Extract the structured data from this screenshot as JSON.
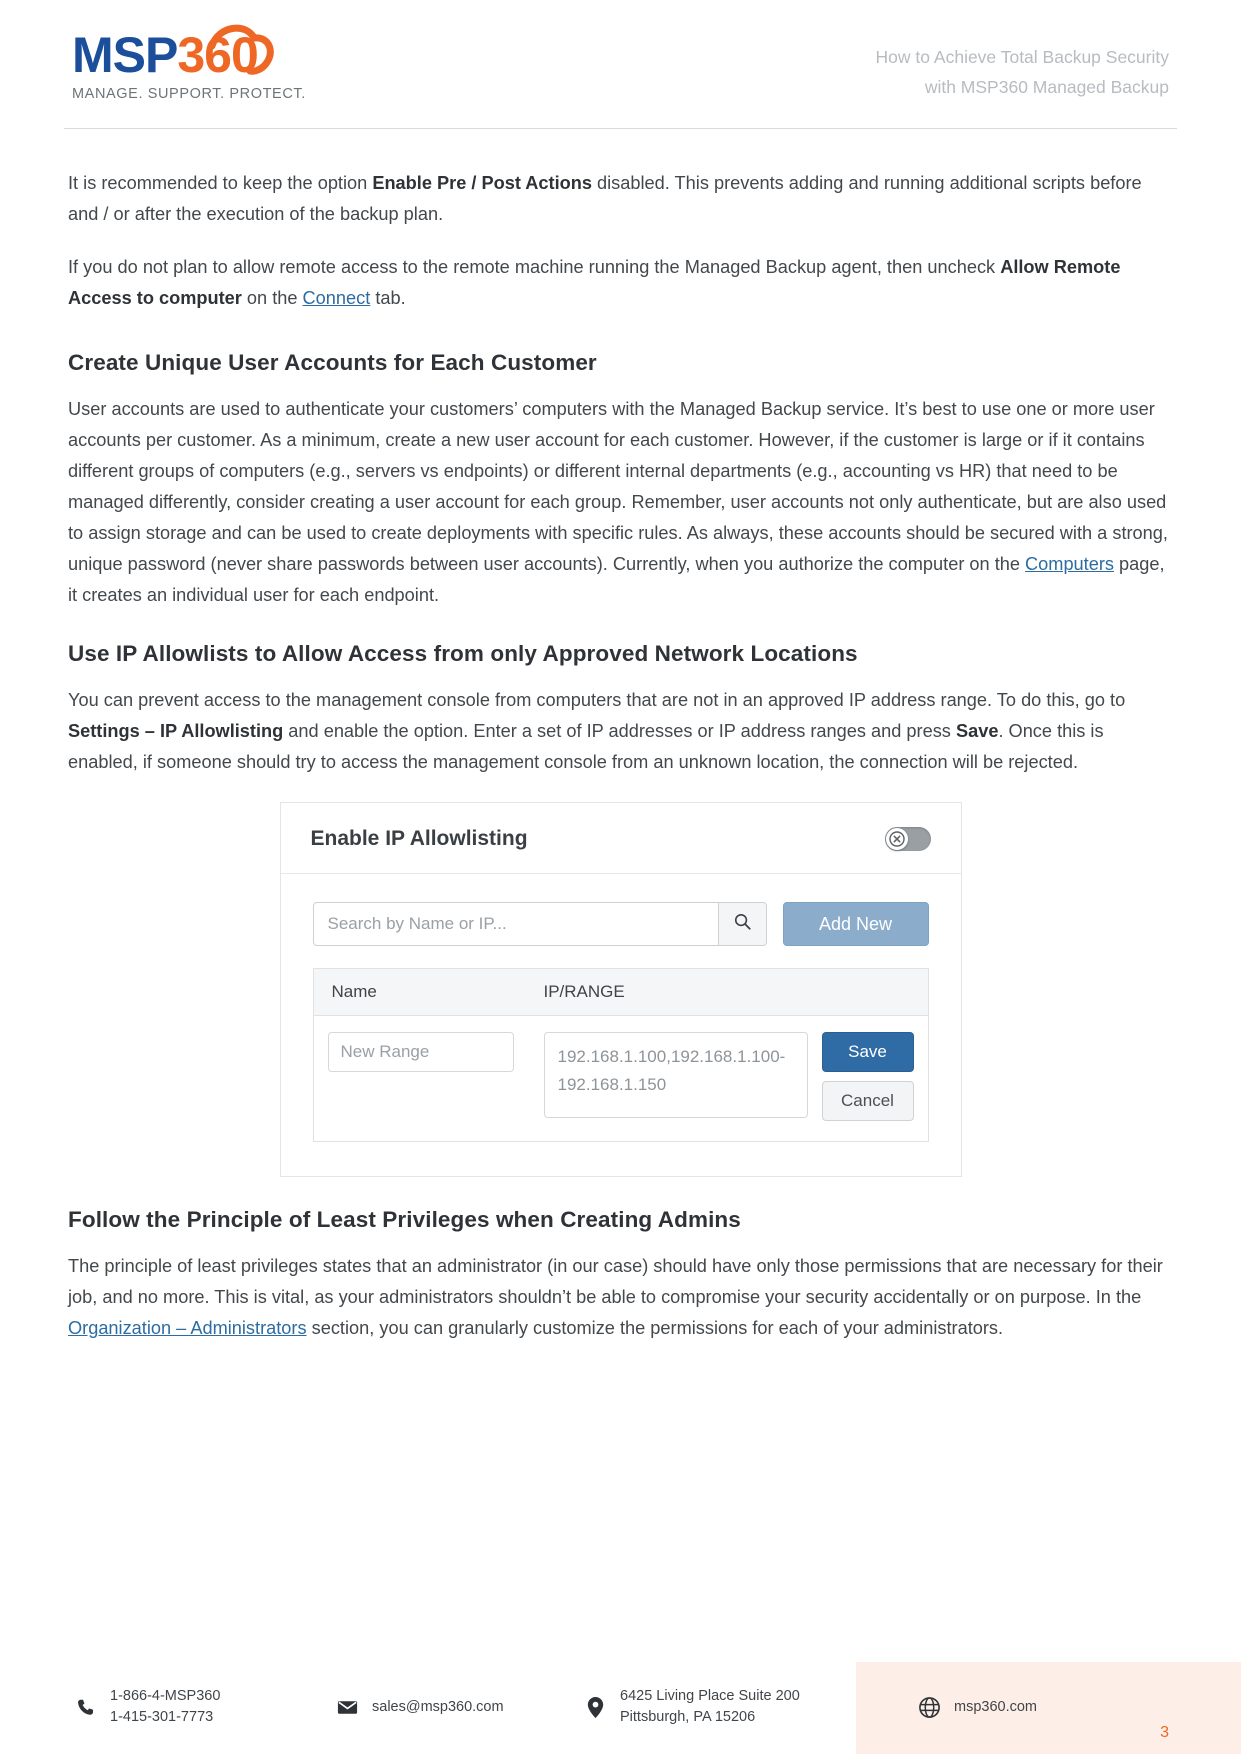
{
  "header": {
    "logo": {
      "part1": "MSP",
      "part2": "360",
      "tagline": "MANAGE. SUPPORT. PROTECT."
    },
    "title_line1": "How to Achieve Total Backup Security",
    "title_line2": "with MSP360 Managed Backup"
  },
  "body": {
    "para1": {
      "t1": "It is recommended to keep the option ",
      "b1": "Enable Pre / Post Actions",
      "t2": " disabled. This prevents adding and running additional scripts before and / or after the execution of the backup plan."
    },
    "para2": {
      "t1": " If you do not plan to allow remote access to the remote machine running the Managed Backup agent, then uncheck ",
      "b1": "Allow Remote Access to computer",
      "t2": " on the ",
      "link": "Connect",
      "t3": " tab."
    },
    "heading1": "Create Unique User Accounts for Each Customer",
    "para3": {
      "t1": "User accounts are used to authenticate your customers’ computers with the Managed Backup service. It’s best to use one or more user accounts per customer. As a minimum, create a new user account for each customer. However, if the customer is large or if it contains different groups of computers (e.g., servers vs endpoints) or different internal departments (e.g., accounting vs HR) that need to be managed differently, consider creating a user account for each group. Remember, user accounts not only authenticate, but are also used to assign storage and can be used to create deployments with specific rules. As always, these accounts should be secured with a strong, unique password (never share passwords between user accounts). Currently, when you authorize the computer on the ",
      "link": "Computers",
      "t2": " page, it creates an individual user for each endpoint."
    },
    "heading2": "Use IP Allowlists to Allow Access from only Approved Network Locations",
    "para4": {
      "t1": "You can prevent access to the management console from computers that are not in an approved IP address range. To do this, go to ",
      "b1": "Settings – IP Allowlisting",
      "t2": " and enable the option. Enter a set of IP addresses or IP address ranges and press ",
      "b2": "Save",
      "t3": ". Once this is enabled, if someone should try to access the management console from an unknown location, the connection will be rejected."
    },
    "heading3": "Follow the Principle of Least Privileges when Creating Admins",
    "para5": {
      "t1": "The principle of least privileges states that an administrator (in our case) should have only those permissions that are necessary for their job, and no more. This is vital, as your administrators shouldn’t be able to compromise your security accidentally or on purpose. In the ",
      "link": "Organization – Administrators",
      "t2": " section, you can granularly customize the permissions for each of your administrators."
    }
  },
  "panel": {
    "title": "Enable IP Allowlisting",
    "toggle_state": "off",
    "toggle_icon": "x-circle-icon",
    "search_placeholder": "Search by Name or IP...",
    "search_value": "",
    "search_icon": "search-icon",
    "add_new_label": "Add New",
    "table": {
      "columns": [
        "Name",
        "IP/RANGE"
      ],
      "row": {
        "name_placeholder": "New Range",
        "name_value": "",
        "range_value": "192.168.1.100,192.168.1.100-192.168.1.150",
        "save_label": "Save",
        "cancel_label": "Cancel"
      }
    }
  },
  "footer": {
    "phone_icon": "phone-icon",
    "phone_line1": "1-866-4-MSP360",
    "phone_line2": "1-415-301-7773",
    "mail_icon": "envelope-icon",
    "email": "sales@msp360.com",
    "addr_icon": "map-pin-icon",
    "addr_line1": "6425 Living Place Suite 200",
    "addr_line2": "Pittsburgh, PA 15206",
    "site_icon": "globe-icon",
    "website": "msp360.com",
    "page_number": "3"
  },
  "colors": {
    "brand_blue": "#1b4f9c",
    "brand_orange": "#ef6724",
    "link": "#2d6ca2",
    "accent_bg": "#fdefe7",
    "button_primary": "#2f6ca5",
    "button_secondary": "#8badcb"
  }
}
